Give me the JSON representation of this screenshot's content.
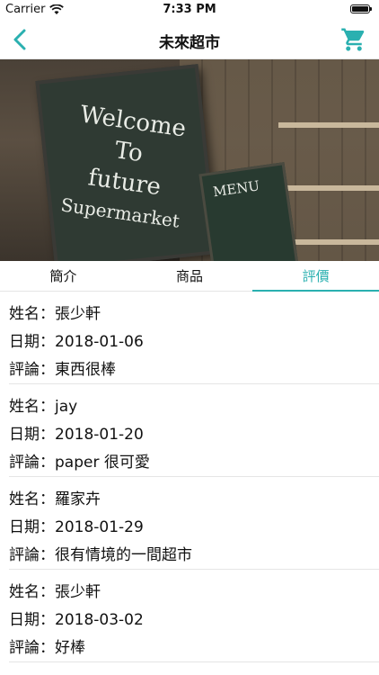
{
  "status": {
    "carrier": "Carrier",
    "time": "7:33 PM"
  },
  "nav": {
    "title": "未來超市",
    "back_icon": "chevron-left-icon",
    "cart_icon": "cart-icon"
  },
  "hero": {
    "board_text": [
      "Welcome",
      "To",
      "future",
      "Supermarket"
    ],
    "menu_text": "MENU"
  },
  "tabs": [
    {
      "label": "簡介",
      "active": false
    },
    {
      "label": "商品",
      "active": false
    },
    {
      "label": "評價",
      "active": true
    }
  ],
  "labels": {
    "name": "姓名：",
    "date": "日期：",
    "comment": "評論："
  },
  "reviews": [
    {
      "name": "張少軒",
      "date": "2018-01-06",
      "comment": "東西很棒"
    },
    {
      "name": "jay",
      "date": "2018-01-20",
      "comment": "paper 很可愛"
    },
    {
      "name": "羅家卉",
      "date": "2018-01-29",
      "comment": "很有情境的一間超市"
    },
    {
      "name": "張少軒",
      "date": "2018-03-02",
      "comment": "好棒"
    }
  ],
  "colors": {
    "accent": "#2ab0b0"
  }
}
